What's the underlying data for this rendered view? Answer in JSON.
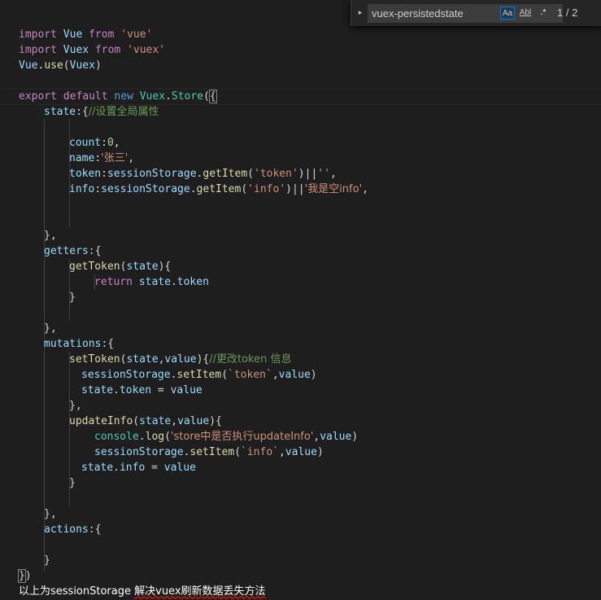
{
  "find_widget": {
    "toggle_icon": "▸",
    "query": "vuex-persistedstate",
    "match_case_label": "Aa",
    "whole_word_label": "Abl",
    "regex_label": ".*",
    "match_count": "1 / 2"
  },
  "code": {
    "l1_kw": "import",
    "l1_id": " Vue ",
    "l1_from": "from",
    "l1_str": " 'vue'",
    "l2_kw": "import",
    "l2_id": " Vuex ",
    "l2_from": "from",
    "l2_str": " 'vuex'",
    "l3_obj": "Vue",
    "l3_dot": ".",
    "l3_fn": "use",
    "l3_open": "(",
    "l3_arg": "Vuex",
    "l3_close": ")",
    "l5_export": "export",
    "l5_default": " default",
    "l5_new": " new",
    "l5_cls": " Vuex",
    "l5_dot": ".",
    "l5_store": "Store",
    "l5_paren": "(",
    "l5_brace": "{",
    "l6_key": "state",
    "l6_punc": ":{",
    "l6_com": "//设置全局属性",
    "l8_key": "count",
    "l8_colon": ":",
    "l8_num": "0",
    "l8_comma": ",",
    "l9_key": "name",
    "l9_colon": ":",
    "l9_str": "'张三'",
    "l9_comma": ",",
    "l10_key": "token",
    "l10_colon": ":",
    "l10_obj": "sessionStorage",
    "l10_dot": ".",
    "l10_fn": "getItem",
    "l10_open": "(",
    "l10_arg": "'token'",
    "l10_close": ")||",
    "l10_str": "''",
    "l10_comma": ",",
    "l11_key": "info",
    "l11_colon": ":",
    "l11_obj": "sessionStorage",
    "l11_dot": ".",
    "l11_fn": "getItem",
    "l11_open": "(",
    "l11_arg": "'info'",
    "l11_close": ")||",
    "l11_str": "'我是空info'",
    "l11_comma": ",",
    "l14": "},",
    "l15_key": "getters",
    "l15_punc": ":{",
    "l16_fn": "getToken",
    "l16_open": "(",
    "l16_param": "state",
    "l16_close": "){",
    "l17_kw": "return",
    "l17_obj": " state",
    "l17_dot": ".",
    "l17_prop": "token",
    "l18": "}",
    "l20": "},",
    "l21_key": "mutations",
    "l21_punc": ":{",
    "l22_fn": "setToken",
    "l22_open": "(",
    "l22_p1": "state",
    "l22_comma": ",",
    "l22_p2": "value",
    "l22_close": "){",
    "l22_com": "//更改token 信息",
    "l23_obj": "sessionStorage",
    "l23_dot": ".",
    "l23_fn": "setItem",
    "l23_open": "(",
    "l23_str": "`token`",
    "l23_comma": ",",
    "l23_arg": "value",
    "l23_close": ")",
    "l24_obj": "state",
    "l24_dot": ".",
    "l24_prop": "token",
    "l24_eq": " = ",
    "l24_val": "value",
    "l25": "},",
    "l26_fn": "updateInfo",
    "l26_open": "(",
    "l26_p1": "state",
    "l26_comma": ",",
    "l26_p2": "value",
    "l26_close": "){",
    "l27_obj": "console",
    "l27_dot": ".",
    "l27_fn": "log",
    "l27_open": "(",
    "l27_str": "'store中是否执行updateInfo'",
    "l27_comma": ",",
    "l27_arg": "value",
    "l27_close": ")",
    "l28_obj": "sessionStorage",
    "l28_dot": ".",
    "l28_fn": "setItem",
    "l28_open": "(",
    "l28_str": "`info`",
    "l28_comma": ",",
    "l28_arg": "value",
    "l28_close": ")",
    "l29_obj": "state",
    "l29_dot": ".",
    "l29_prop": "info",
    "l29_eq": " = ",
    "l29_val": "value",
    "l30": "}",
    "l32": "},",
    "l33_key": "actions",
    "l33_punc": ":{",
    "l35": "}",
    "l36_brace": "}",
    "l36_paren": ")"
  },
  "footer": {
    "prefix": "以上为sessionStorage ",
    "underlined": "解决vuex刷新数据丢失方法"
  },
  "colors": {
    "background": "#1e1e1e",
    "keyword": "#c586c0",
    "string": "#ce9178",
    "variable": "#9cdcfe",
    "function": "#dcdcaa",
    "comment": "#6a9955",
    "accent": "#007acc"
  }
}
